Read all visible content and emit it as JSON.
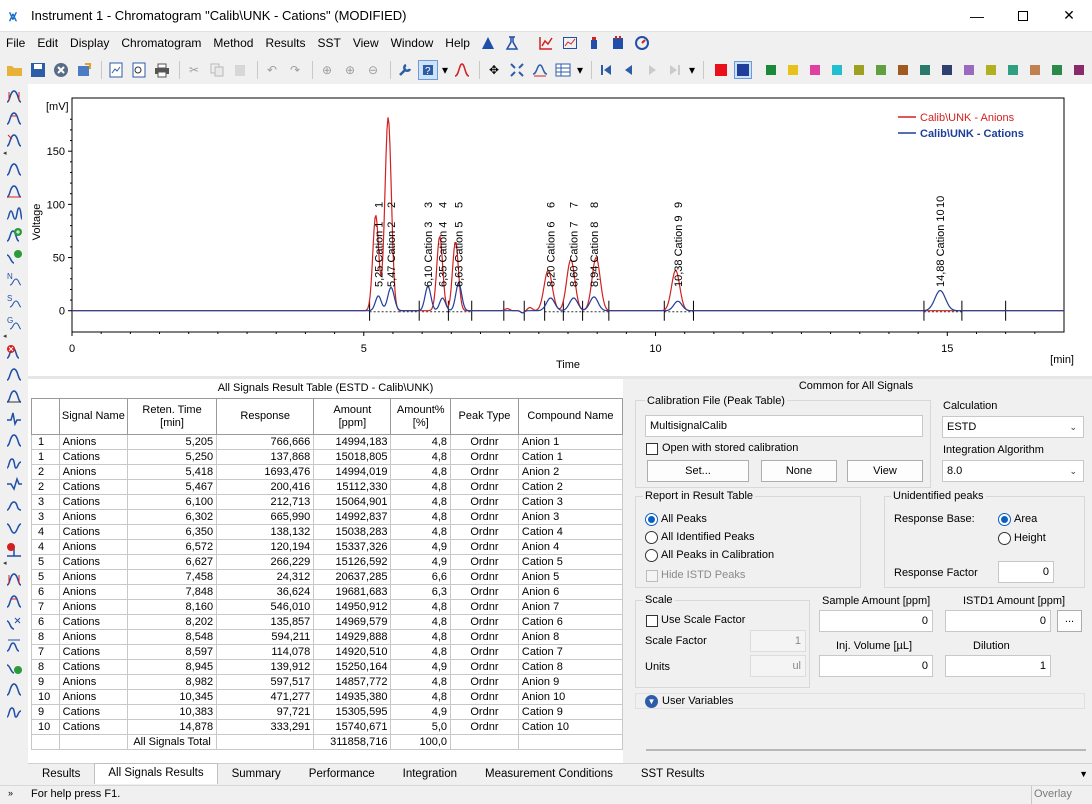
{
  "window": {
    "title": "Instrument 1 - Chromatogram \"Calib\\UNK - Cations\" (MODIFIED)"
  },
  "menu": [
    "File",
    "Edit",
    "Display",
    "Chromatogram",
    "Method",
    "Results",
    "SST",
    "View",
    "Window",
    "Help"
  ],
  "colors": {
    "anions": "#d42020",
    "cations": "#1f3f9a",
    "accent": "#0a5fc2"
  },
  "chart_data": {
    "type": "line",
    "ylabel": "Voltage",
    "yunit": "[mV]",
    "xlabel": "Time",
    "xunit": "[min]",
    "xticks": [
      "0",
      "5",
      "10",
      "15"
    ],
    "yticks": [
      "0",
      "50",
      "100",
      "150"
    ],
    "xlim": [
      0,
      17.0
    ],
    "ylim": [
      -20,
      200
    ],
    "legend_position": "top-right",
    "series": [
      {
        "name": "Calib\\UNK - Anions",
        "color": "#d42020",
        "peaks": [
          [
            5.205,
            90,
            0.05
          ],
          [
            5.418,
            182,
            0.055
          ],
          [
            6.302,
            70,
            0.05
          ],
          [
            6.572,
            65,
            0.05
          ],
          [
            7.458,
            2,
            0.04
          ],
          [
            7.848,
            3,
            0.04
          ],
          [
            8.16,
            38,
            0.07
          ],
          [
            8.548,
            48,
            0.07
          ],
          [
            8.982,
            50,
            0.07
          ],
          [
            10.345,
            38,
            0.07
          ]
        ]
      },
      {
        "name": "Calib\\UNK - Cations",
        "color": "#1f3f9a",
        "peaks": [
          [
            5.25,
            14,
            0.05
          ],
          [
            5.467,
            22,
            0.055
          ],
          [
            6.1,
            23,
            0.05
          ],
          [
            6.35,
            12,
            0.05
          ],
          [
            6.627,
            26,
            0.05
          ],
          [
            8.202,
            12,
            0.07
          ],
          [
            8.597,
            12,
            0.07
          ],
          [
            8.945,
            13,
            0.07
          ],
          [
            10.383,
            9,
            0.07
          ],
          [
            14.878,
            19,
            0.09
          ]
        ]
      }
    ],
    "peak_labels": [
      {
        "x": 5.25,
        "text": "5,25 Cation 1",
        "num": "1"
      },
      {
        "x": 5.467,
        "text": "5,47 Cation 2",
        "num": "2"
      },
      {
        "x": 6.1,
        "text": "6,10 Cation 3",
        "num": "3"
      },
      {
        "x": 6.35,
        "text": "6,35 Cation 4",
        "num": "4"
      },
      {
        "x": 6.627,
        "text": "6,63 Cation 5",
        "num": "5"
      },
      {
        "x": 8.202,
        "text": "8,20 Cation 6",
        "num": "6"
      },
      {
        "x": 8.597,
        "text": "8,60 Cation 7",
        "num": "7"
      },
      {
        "x": 8.945,
        "text": "8,94 Cation 8",
        "num": "8"
      },
      {
        "x": 10.383,
        "text": "10,38 Cation 9",
        "num": "9"
      },
      {
        "x": 14.878,
        "text": "14,88 Cation 10",
        "num": "10"
      }
    ]
  },
  "result_table": {
    "caption": "All Signals Result Table (ESTD - Calib\\UNK)",
    "headers": [
      "",
      "Signal Name",
      "Reten. Time\n[min]",
      "Response",
      "Amount\n[ppm]",
      "Amount%\n[%]",
      "Peak Type",
      "Compound Name"
    ],
    "rows": [
      [
        "1",
        "Anions",
        "5,205",
        "766,666",
        "14994,183",
        "4,8",
        "Ordnr",
        "Anion 1"
      ],
      [
        "1",
        "Cations",
        "5,250",
        "137,868",
        "15018,805",
        "4,8",
        "Ordnr",
        "Cation 1"
      ],
      [
        "2",
        "Anions",
        "5,418",
        "1693,476",
        "14994,019",
        "4,8",
        "Ordnr",
        "Anion 2"
      ],
      [
        "2",
        "Cations",
        "5,467",
        "200,416",
        "15112,330",
        "4,8",
        "Ordnr",
        "Cation 2"
      ],
      [
        "3",
        "Cations",
        "6,100",
        "212,713",
        "15064,901",
        "4,8",
        "Ordnr",
        "Cation 3"
      ],
      [
        "3",
        "Anions",
        "6,302",
        "665,990",
        "14992,837",
        "4,8",
        "Ordnr",
        "Anion 3"
      ],
      [
        "4",
        "Cations",
        "6,350",
        "138,132",
        "15038,283",
        "4,8",
        "Ordnr",
        "Cation 4"
      ],
      [
        "4",
        "Anions",
        "6,572",
        "120,194",
        "15337,326",
        "4,9",
        "Ordnr",
        "Anion 4"
      ],
      [
        "5",
        "Cations",
        "6,627",
        "266,229",
        "15126,592",
        "4,9",
        "Ordnr",
        "Cation 5"
      ],
      [
        "5",
        "Anions",
        "7,458",
        "24,312",
        "20637,285",
        "6,6",
        "Ordnr",
        "Anion 5"
      ],
      [
        "6",
        "Anions",
        "7,848",
        "36,624",
        "19681,683",
        "6,3",
        "Ordnr",
        "Anion 6"
      ],
      [
        "7",
        "Anions",
        "8,160",
        "546,010",
        "14950,912",
        "4,8",
        "Ordnr",
        "Anion 7"
      ],
      [
        "6",
        "Cations",
        "8,202",
        "135,857",
        "14969,579",
        "4,8",
        "Ordnr",
        "Cation 6"
      ],
      [
        "8",
        "Anions",
        "8,548",
        "594,211",
        "14929,888",
        "4,8",
        "Ordnr",
        "Anion 8"
      ],
      [
        "7",
        "Cations",
        "8,597",
        "114,078",
        "14920,510",
        "4,8",
        "Ordnr",
        "Cation 7"
      ],
      [
        "8",
        "Cations",
        "8,945",
        "139,912",
        "15250,164",
        "4,9",
        "Ordnr",
        "Cation 8"
      ],
      [
        "9",
        "Anions",
        "8,982",
        "597,517",
        "14857,772",
        "4,8",
        "Ordnr",
        "Anion 9"
      ],
      [
        "10",
        "Anions",
        "10,345",
        "471,277",
        "14935,380",
        "4,8",
        "Ordnr",
        "Anion 10"
      ],
      [
        "9",
        "Cations",
        "10,383",
        "97,721",
        "15305,595",
        "4,9",
        "Ordnr",
        "Cation 9"
      ],
      [
        "10",
        "Cations",
        "14,878",
        "333,291",
        "15740,671",
        "5,0",
        "Ordnr",
        "Cation 10"
      ]
    ],
    "total": {
      "label": "All Signals Total",
      "amount": "311858,716",
      "percent": "100,0"
    }
  },
  "right": {
    "header": "Common for All Signals",
    "calib_group": "Calibration File (Peak Table)",
    "calib_file": "MultisignalCalib",
    "open_stored": "Open with stored calibration",
    "btn_set": "Set...",
    "btn_none": "None",
    "btn_view": "View",
    "calculation_label": "Calculation",
    "calculation_value": "ESTD",
    "integration_label": "Integration Algorithm",
    "integration_value": "8.0",
    "report_group": "Report in Result Table",
    "report_options": [
      "All Peaks",
      "All Identified Peaks",
      "All Peaks in Calibration"
    ],
    "hide_istd": "Hide ISTD Peaks",
    "unident_group": "Unidentified peaks",
    "response_base_label": "Response Base:",
    "area": "Area",
    "height": "Height",
    "response_factor_label": "Response Factor",
    "response_factor_value": "0",
    "scale_group": "Scale",
    "use_scale_factor": "Use Scale Factor",
    "scale_factor_label": "Scale Factor",
    "scale_factor_value": "1",
    "units_label": "Units",
    "units_value": "ul",
    "sample_amount_label": "Sample Amount [ppm]",
    "sample_amount_value": "0",
    "istd_amount_label": "ISTD1 Amount [ppm]",
    "istd_amount_value": "0",
    "ellipsis": "...",
    "inj_volume_label": "Inj. Volume [µL]",
    "inj_volume_value": "0",
    "dilution_label": "Dilution",
    "dilution_value": "1",
    "user_variables": "User Variables"
  },
  "tabs": [
    "Results",
    "All Signals Results",
    "Summary",
    "Performance",
    "Integration",
    "Measurement Conditions",
    "SST Results"
  ],
  "active_tab": "All Signals Results",
  "status": {
    "left": "For help press F1.",
    "right": "Overlay"
  }
}
